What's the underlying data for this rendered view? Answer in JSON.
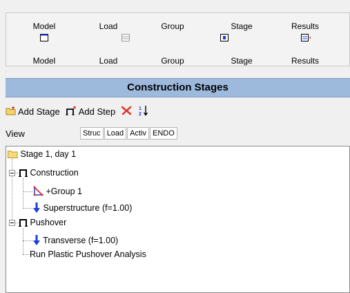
{
  "tabs": [
    {
      "top_label": "Model",
      "bottom_label": "Model"
    },
    {
      "top_label": "Load",
      "bottom_label": "Load"
    },
    {
      "top_label": "Group",
      "bottom_label": "Group"
    },
    {
      "top_label": "Stage",
      "bottom_label": "Stage"
    },
    {
      "top_label": "Results",
      "bottom_label": "Results"
    }
  ],
  "panel": {
    "title": "Construction Stages"
  },
  "toolbar": {
    "add_stage": "Add Stage",
    "add_step": "Add Step"
  },
  "view": {
    "label": "View",
    "buttons": [
      "Struc",
      "Load",
      "Activ",
      "ENDO"
    ]
  },
  "tree": {
    "stage": "Stage 1, day 1",
    "construction": "Construction",
    "group": "+Group 1",
    "superstructure": "Superstructure (f=1.00)",
    "pushover": "Pushover",
    "transverse": "Transverse (f=1.00)",
    "run": "Run Plastic Pushover Analysis"
  },
  "colors": {
    "header_bg": "#9db9dc",
    "accent_blue": "#1a3fd6",
    "delete_red": "#e0302a"
  }
}
